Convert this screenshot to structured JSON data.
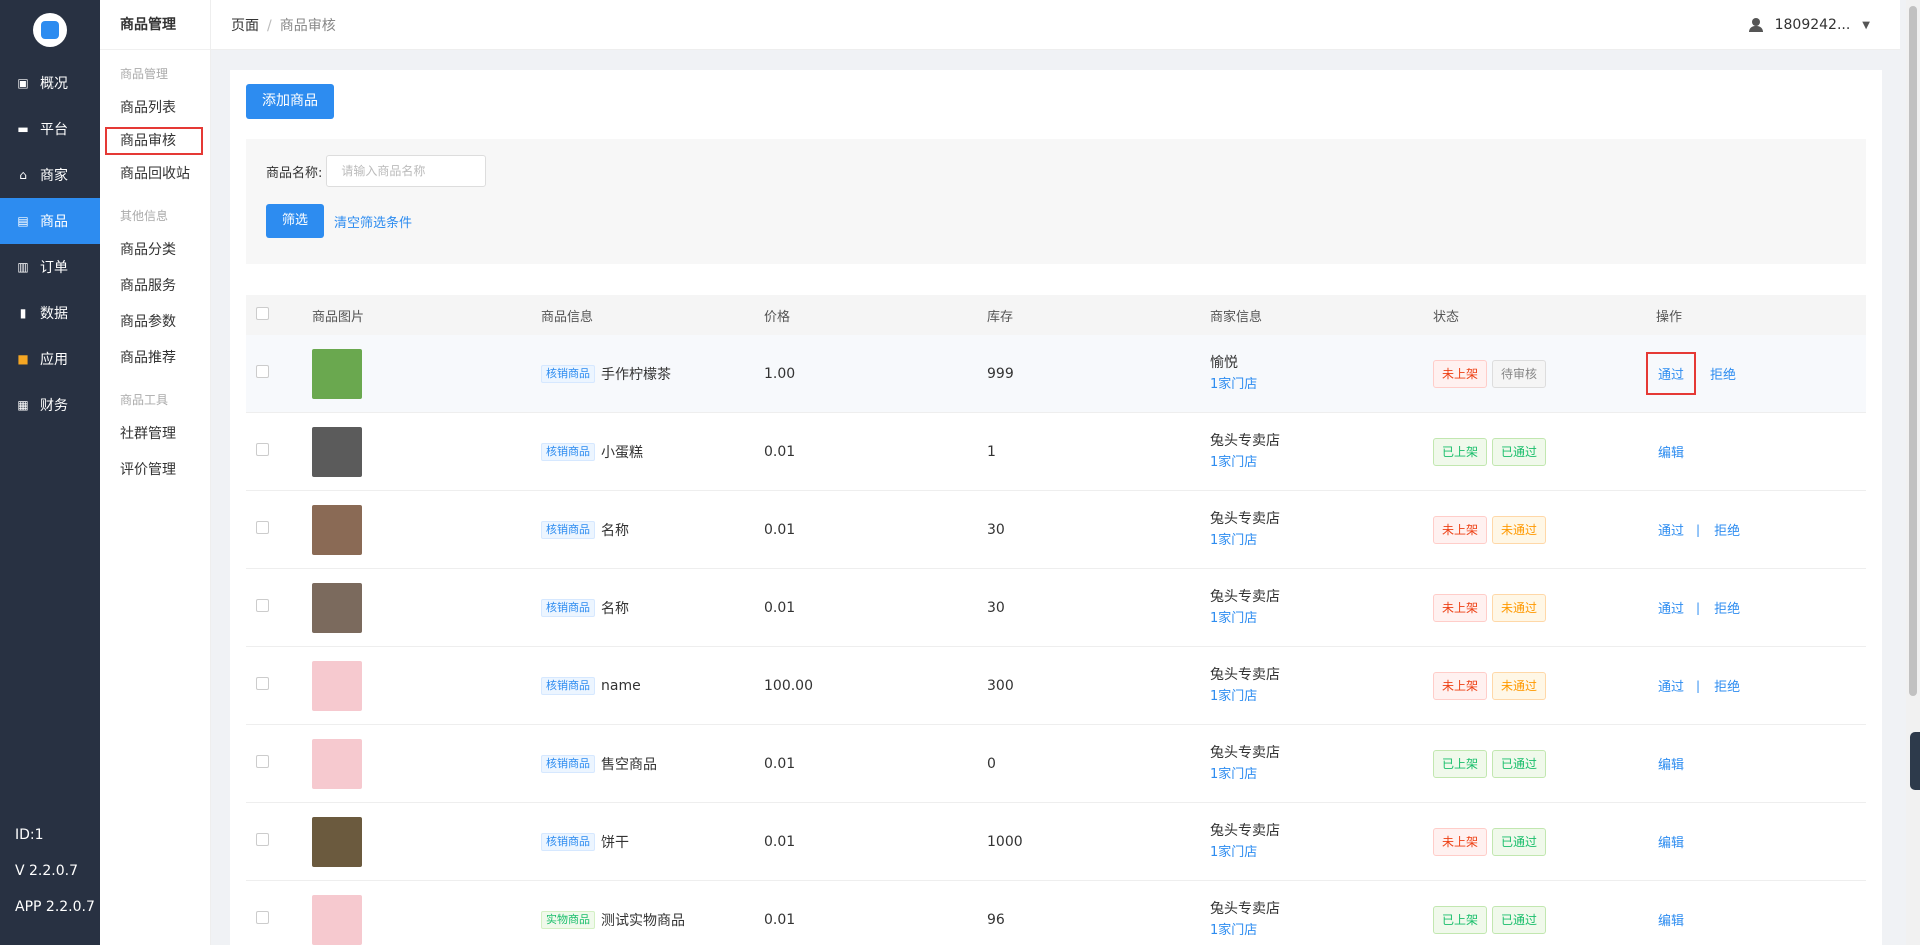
{
  "nav": {
    "items": [
      {
        "label": "概况",
        "icon": "dashboard-icon"
      },
      {
        "label": "平台",
        "icon": "monitor-icon"
      },
      {
        "label": "商家",
        "icon": "store-icon"
      },
      {
        "label": "商品",
        "icon": "goods-icon"
      },
      {
        "label": "订单",
        "icon": "order-icon"
      },
      {
        "label": "数据",
        "icon": "chart-icon"
      },
      {
        "label": "应用",
        "icon": "apps-icon"
      },
      {
        "label": "财务",
        "icon": "finance-icon"
      }
    ],
    "active": "商品",
    "id_text": "ID:1",
    "version": "V 2.2.0.7",
    "app_version": "APP 2.2.0.7"
  },
  "subnav": {
    "title": "商品管理",
    "group1": "商品管理",
    "items1": [
      "商品列表",
      "商品审核",
      "商品回收站"
    ],
    "group2": "其他信息",
    "items2": [
      "商品分类",
      "商品服务",
      "商品参数",
      "商品推荐"
    ],
    "group3": "商品工具",
    "items3": [
      "社群管理",
      "评价管理"
    ]
  },
  "topbar": {
    "crumb_root": "页面",
    "crumb_sep": "/",
    "crumb_current": "商品审核",
    "user": "1809242..."
  },
  "toolbar": {
    "add_label": "添加商品"
  },
  "filter": {
    "name_label": "商品名称:",
    "name_placeholder": "请输入商品名称",
    "submit_label": "筛选",
    "clear_label": "清空筛选条件"
  },
  "table": {
    "headers": [
      "商品图片",
      "商品信息",
      "价格",
      "库存",
      "商家信息",
      "状态",
      "操作"
    ],
    "rows": [
      {
        "tag": "核销商品",
        "tag_color": "blue",
        "name": "手作柠檬茶",
        "price": "1.00",
        "stock": "999",
        "shop": "愉悦",
        "stores": "1家门店",
        "s1": "未上架",
        "s1c": "red",
        "s2": "待审核",
        "s2c": "gray",
        "ops": [
          "通过",
          "拒绝"
        ],
        "img": "#6aa84f"
      },
      {
        "tag": "核销商品",
        "tag_color": "blue",
        "name": "小蛋糕",
        "price": "0.01",
        "stock": "1",
        "shop": "兔头专卖店",
        "stores": "1家门店",
        "s1": "已上架",
        "s1c": "green",
        "s2": "已通过",
        "s2c": "green",
        "ops": [
          "编辑"
        ],
        "img": "#5b5b5b"
      },
      {
        "tag": "核销商品",
        "tag_color": "blue",
        "name": "名称",
        "price": "0.01",
        "stock": "30",
        "shop": "兔头专卖店",
        "stores": "1家门店",
        "s1": "未上架",
        "s1c": "red",
        "s2": "未通过",
        "s2c": "orange",
        "ops": [
          "通过",
          "拒绝"
        ],
        "img": "#8a6a55"
      },
      {
        "tag": "核销商品",
        "tag_color": "blue",
        "name": "名称",
        "price": "0.01",
        "stock": "30",
        "shop": "兔头专卖店",
        "stores": "1家门店",
        "s1": "未上架",
        "s1c": "red",
        "s2": "未通过",
        "s2c": "orange",
        "ops": [
          "通过",
          "拒绝"
        ],
        "img": "#7b6a5d"
      },
      {
        "tag": "核销商品",
        "tag_color": "blue",
        "name": "name",
        "price": "100.00",
        "stock": "300",
        "shop": "兔头专卖店",
        "stores": "1家门店",
        "s1": "未上架",
        "s1c": "red",
        "s2": "未通过",
        "s2c": "orange",
        "ops": [
          "通过",
          "拒绝"
        ],
        "img": "#f6c9cf"
      },
      {
        "tag": "核销商品",
        "tag_color": "blue",
        "name": "售空商品",
        "price": "0.01",
        "stock": "0",
        "shop": "兔头专卖店",
        "stores": "1家门店",
        "s1": "已上架",
        "s1c": "green",
        "s2": "已通过",
        "s2c": "green",
        "ops": [
          "编辑"
        ],
        "img": "#f6c9cf"
      },
      {
        "tag": "核销商品",
        "tag_color": "blue",
        "name": "饼干",
        "price": "0.01",
        "stock": "1000",
        "shop": "兔头专卖店",
        "stores": "1家门店",
        "s1": "未上架",
        "s1c": "red",
        "s2": "已通过",
        "s2c": "green",
        "ops": [
          "编辑"
        ],
        "img": "#6b5a3e"
      },
      {
        "tag": "实物商品",
        "tag_color": "green",
        "name": "测试实物商品",
        "price": "0.01",
        "stock": "96",
        "shop": "兔头专卖店",
        "stores": "1家门店",
        "s1": "已上架",
        "s1c": "green",
        "s2": "已通过",
        "s2c": "green",
        "ops": [
          "编辑"
        ],
        "img": "#f6c9cf"
      }
    ]
  },
  "colors": {
    "sidebar": "#283142",
    "accent": "#2d8cf0",
    "highlight": "#e53935"
  }
}
